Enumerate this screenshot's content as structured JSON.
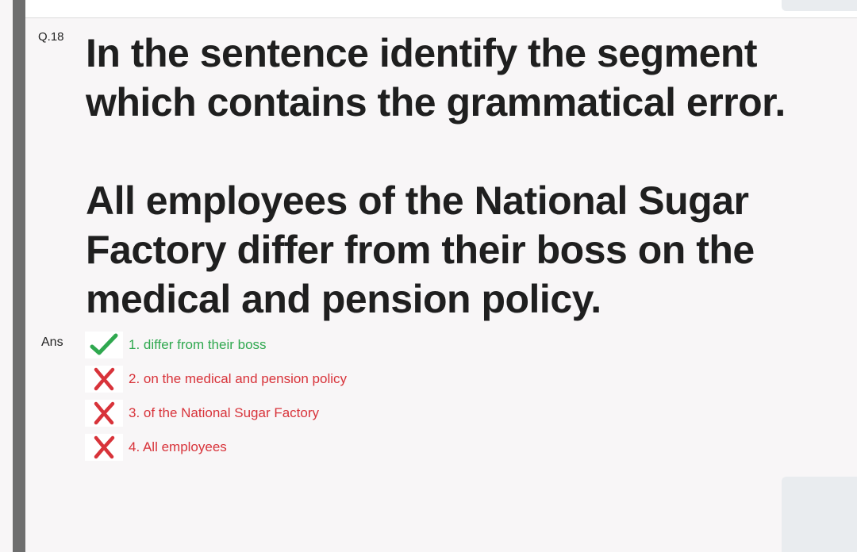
{
  "question": {
    "number": "Q.18",
    "prompt_lines": [
      "In the sentence identify the segment",
      "which contains the grammatical error."
    ],
    "sentence_lines": [
      "All employees of the National Sugar",
      "Factory differ from their boss on the",
      "medical and pension policy."
    ]
  },
  "answer": {
    "label": "Ans",
    "options": [
      {
        "text": "1. differ from their boss",
        "status": "correct",
        "icon": "check-icon"
      },
      {
        "text": "2. on the medical and pension policy",
        "status": "wrong",
        "icon": "cross-icon"
      },
      {
        "text": "3. of the National Sugar Factory",
        "status": "wrong",
        "icon": "cross-icon"
      },
      {
        "text": "4. All employees",
        "status": "wrong",
        "icon": "cross-icon"
      }
    ]
  },
  "colors": {
    "correct": "#2fa84f",
    "wrong": "#d8333a",
    "left_bar": "#6e6e6e",
    "background": "#f8f6f7"
  }
}
